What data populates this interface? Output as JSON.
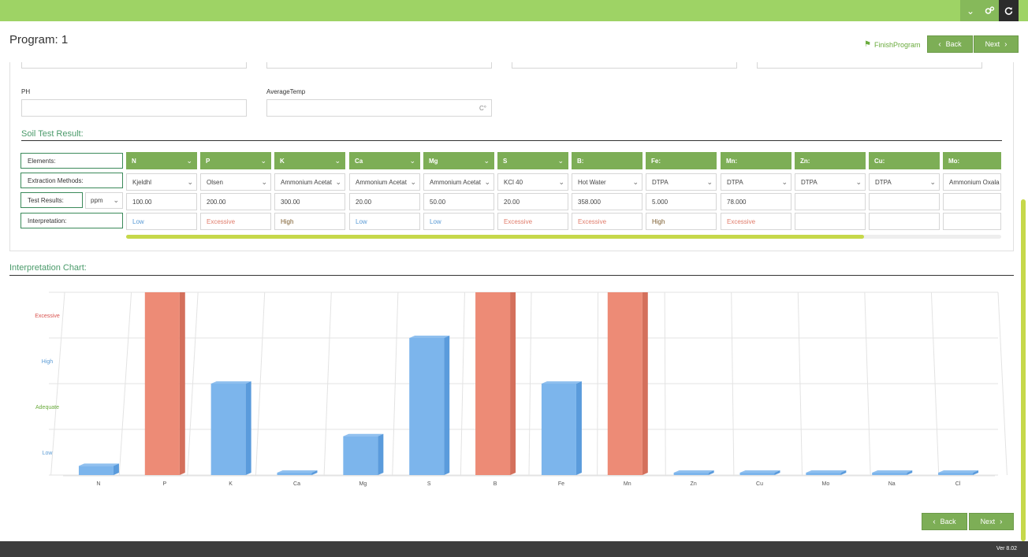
{
  "header": {
    "program_title": "Program: 1",
    "finish_label": "FinishProgram",
    "back_label": "Back",
    "next_label": "Next",
    "icons": [
      "chevron-down-icon",
      "gears-icon",
      "refresh-icon"
    ]
  },
  "form": {
    "ph_label": "PH",
    "ph_value": "",
    "avgtemp_label": "AverageTemp",
    "avgtemp_unit": "C°"
  },
  "soil": {
    "title": "Soil Test Result:",
    "row_labels": {
      "elements": "Elements:",
      "methods": "Extraction Methods:",
      "results": "Test Results:",
      "interpretation": "Interpretation:"
    },
    "unit": "ppm",
    "columns": [
      {
        "element": "N",
        "method": "Kjeldhl",
        "value": "100.00",
        "interp": "Low",
        "has_dd": true,
        "method_dd": true
      },
      {
        "element": "P",
        "method": "Olsen",
        "value": "200.00",
        "interp": "Excessive",
        "has_dd": true,
        "method_dd": true
      },
      {
        "element": "K",
        "method": "Ammonium Acetat",
        "value": "300.00",
        "interp": "High",
        "has_dd": true,
        "method_dd": true
      },
      {
        "element": "Ca",
        "method": "Ammonium Acetat",
        "value": "20.00",
        "interp": "Low",
        "has_dd": true,
        "method_dd": true
      },
      {
        "element": "Mg",
        "method": "Ammonium Acetat",
        "value": "50.00",
        "interp": "Low",
        "has_dd": true,
        "method_dd": true
      },
      {
        "element": "S",
        "method": "KCl 40",
        "value": "20.00",
        "interp": "Excessive",
        "has_dd": true,
        "method_dd": true
      },
      {
        "element": "B:",
        "method": "Hot Water",
        "value": "358.000",
        "interp": "Excessive",
        "has_dd": false,
        "method_dd": true
      },
      {
        "element": "Fe:",
        "method": "DTPA",
        "value": "5.000",
        "interp": "High",
        "has_dd": false,
        "method_dd": true
      },
      {
        "element": "Mn:",
        "method": "DTPA",
        "value": "78.000",
        "interp": "Excessive",
        "has_dd": false,
        "method_dd": true
      },
      {
        "element": "Zn:",
        "method": "DTPA",
        "value": "",
        "interp": "",
        "has_dd": false,
        "method_dd": true
      },
      {
        "element": "Cu:",
        "method": "DTPA",
        "value": "",
        "interp": "",
        "has_dd": false,
        "method_dd": true
      },
      {
        "element": "Mo:",
        "method": "Ammonium Oxala",
        "value": "",
        "interp": "",
        "has_dd": false,
        "method_dd": false
      }
    ],
    "interp_colors": {
      "Low": "#5b9bd5",
      "Excessive": "#e07b6a",
      "High": "#7a5a2a"
    }
  },
  "chart": {
    "title": "Interpretation Chart:"
  },
  "chart_data": {
    "type": "bar",
    "categories": [
      "N",
      "P",
      "K",
      "Ca",
      "Mg",
      "S",
      "B",
      "Fe",
      "Mn",
      "Zn",
      "Cu",
      "Mo",
      "Na",
      "Cl"
    ],
    "values": [
      0.2,
      4.0,
      2.0,
      0.05,
      0.85,
      3.0,
      4.0,
      2.0,
      4.0,
      0.05,
      0.05,
      0.05,
      0.05,
      0.05
    ],
    "colors": [
      "#7cb5ec",
      "#ed8b76",
      "#7cb5ec",
      "#7cb5ec",
      "#7cb5ec",
      "#7cb5ec",
      "#ed8b76",
      "#7cb5ec",
      "#ed8b76",
      "#7cb5ec",
      "#7cb5ec",
      "#7cb5ec",
      "#7cb5ec",
      "#7cb5ec"
    ],
    "y_levels": [
      {
        "label": "Low",
        "value": 0.5,
        "color": "#5b9bd5"
      },
      {
        "label": "Adequate",
        "value": 1.5,
        "color": "#6aab3d"
      },
      {
        "label": "High",
        "value": 2.5,
        "color": "#5b9bd5"
      },
      {
        "label": "Excessive",
        "value": 3.5,
        "color": "#d9534f"
      }
    ],
    "ylim": [
      0,
      4
    ],
    "grid": true
  },
  "footer": {
    "version": "Ver 8.02"
  }
}
